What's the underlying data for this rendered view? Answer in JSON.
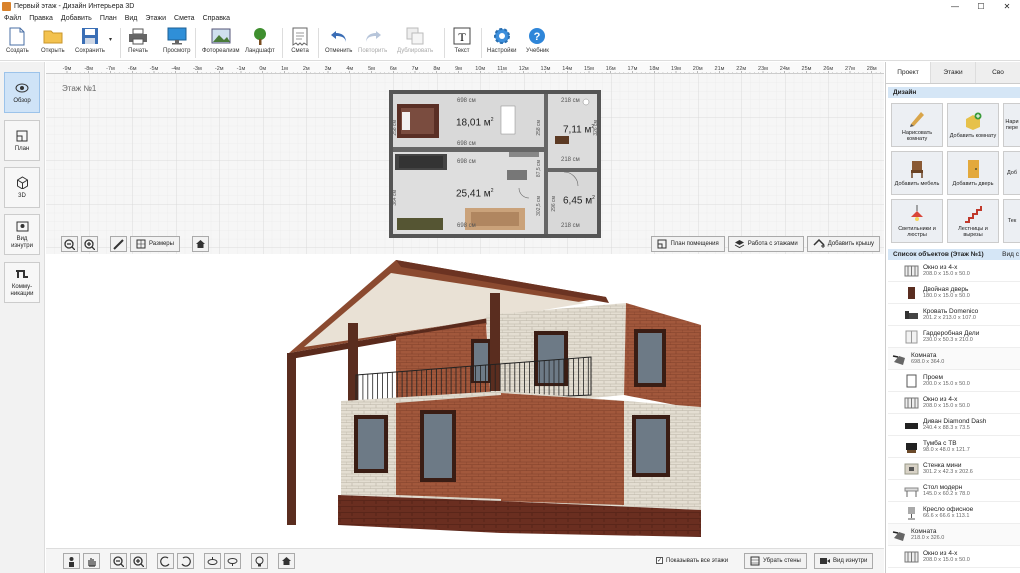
{
  "window": {
    "title": "Первый этаж - Дизайн Интерьера 3D"
  },
  "menu": [
    "Файл",
    "Правка",
    "Добавить",
    "План",
    "Вид",
    "Этажи",
    "Смета",
    "Справка"
  ],
  "toolbar": {
    "create": "Создать",
    "open": "Открыть",
    "save": "Сохранить",
    "print": "Печать",
    "preview": "Просмотр",
    "photoreal": "Фотореализм",
    "landscape": "Ландшафт",
    "estimate": "Смета",
    "undo": "Отменить",
    "redo": "Повторить",
    "duplicate": "Дублировать",
    "text": "Текст",
    "settings": "Настройки",
    "tutorial": "Учебник"
  },
  "leftbar": {
    "overview": "Обзор",
    "plan": "План",
    "three_d": "3D",
    "inside_view": "Вид изнутри",
    "comms": "Комму-никации"
  },
  "plan": {
    "floor_label": "Этаж №1",
    "ruler": [
      "-9м",
      "-8м",
      "-7м",
      "-6м",
      "-5м",
      "-4м",
      "-3м",
      "-2м",
      "-1м",
      "0м",
      "1м",
      "2м",
      "3м",
      "4м",
      "5м",
      "6м",
      "7м",
      "8м",
      "9м",
      "10м",
      "11м",
      "12м",
      "13м",
      "14м",
      "15м",
      "16м",
      "17м",
      "18м",
      "19м",
      "20м",
      "21м",
      "22м",
      "23м",
      "24м",
      "25м",
      "26м",
      "27м",
      "28м"
    ],
    "rooms": [
      {
        "area": "18,01 м",
        "w_top": "698 см",
        "w_bottom": "698 см",
        "h_left": "258 см",
        "h_right": "258 см"
      },
      {
        "area": "7,11 м",
        "w_top": "218 см",
        "w_bottom": "218 см",
        "h_right": "326 см"
      },
      {
        "area": "25,41 м",
        "w_top": "698 см",
        "w_bottom": "698 см",
        "h_left": "364 см",
        "h_right": "302,5 см",
        "h_mid": "87,5 см"
      },
      {
        "area": "6,45 м",
        "w_bottom": "218 см",
        "h_left": "296 см"
      }
    ],
    "sup": "2",
    "sizes_label": "Размеры",
    "room_plan": "План помещения",
    "floors_work": "Работа с этажами",
    "add_roof": "Добавить крышу"
  },
  "bottom3d": {
    "show_all_floors": "Показывать все этажи",
    "remove_walls": "Убрать стены",
    "inside_view": "Вид изнутри"
  },
  "right": {
    "tabs": [
      "Проект",
      "Этажи",
      "Сво"
    ],
    "design_header": "Дизайн",
    "design_buttons": [
      {
        "label": "Нарисовать комнату"
      },
      {
        "label": "Добавить комнату"
      },
      {
        "label": "Нари пере"
      },
      {
        "label": "Добавить мебель"
      },
      {
        "label": "Добавить дверь"
      },
      {
        "label": "Доб"
      },
      {
        "label": "Светильники и люстры"
      },
      {
        "label": "Лестницы и вырезы"
      },
      {
        "label": "Тек"
      }
    ],
    "objects_header": "Список объектов (Этаж №1)",
    "objects_header_right": "Вид с",
    "objects": [
      {
        "name": "Окно из 4-х",
        "size": "208.0 x 15.0 x 50.0",
        "group": false
      },
      {
        "name": "Двойная дверь",
        "size": "180.0 x 15.0 x 50.0",
        "group": false
      },
      {
        "name": "Кровать Domenico",
        "size": "201.2 x 213.0 x 107.0",
        "group": false
      },
      {
        "name": "Гардеробная Дели",
        "size": "230.0 x 50.3 x 210.0",
        "group": false
      },
      {
        "name": "Комната",
        "size": "698.0 x 364.0",
        "group": true
      },
      {
        "name": "Проем",
        "size": "200.0 x 15.0 x 50.0",
        "group": false
      },
      {
        "name": "Окно из 4-х",
        "size": "208.0 x 15.0 x 50.0",
        "group": false
      },
      {
        "name": "Диван Diamond Dash",
        "size": "240.4 x 88.3 x 73.5",
        "group": false
      },
      {
        "name": "Тумба с ТВ",
        "size": "98.0 x 48.0 x 121.7",
        "group": false
      },
      {
        "name": "Стенка мини",
        "size": "301.2 x 42.3 x 202.6",
        "group": false
      },
      {
        "name": "Стол модерн",
        "size": "145.0 x 60.2 x 78.0",
        "group": false
      },
      {
        "name": "Кресло офисное",
        "size": "66.6 x 66.6 x 113.1",
        "group": false
      },
      {
        "name": "Комната",
        "size": "218.0 x 326.0",
        "group": true
      },
      {
        "name": "Окно из 4-х",
        "size": "208.0 x 15.0 x 50.0",
        "group": false
      }
    ]
  }
}
